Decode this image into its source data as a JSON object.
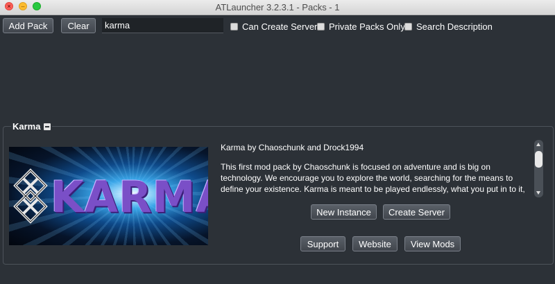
{
  "window": {
    "title": "ATLauncher 3.2.3.1 - Packs - 1"
  },
  "toolbar": {
    "add_pack_label": "Add Pack",
    "clear_label": "Clear",
    "search_value": "karma",
    "can_create_server_label": "Can Create Server",
    "private_packs_only_label": "Private Packs Only",
    "search_description_label": "Search Description"
  },
  "pack": {
    "name": "Karma",
    "banner_text": "KARMA",
    "byline": "Karma by Chaoschunk and Drock1994",
    "description": "This first mod pack by Chaoschunk is focused on adventure and is big on technology.  We encourage you to explore the world, searching for the means to define your existence.  Karma is meant to be played endlessly, what you put in to it, is what you get out!  Come see what Karma holds for you!",
    "new_instance_label": "New Instance",
    "create_server_label": "Create Server",
    "support_label": "Support",
    "website_label": "Website",
    "view_mods_label": "View Mods"
  },
  "colors": {
    "background": "#2c3137",
    "button": "#4a5057",
    "banner_text": "#7a4fc7"
  }
}
